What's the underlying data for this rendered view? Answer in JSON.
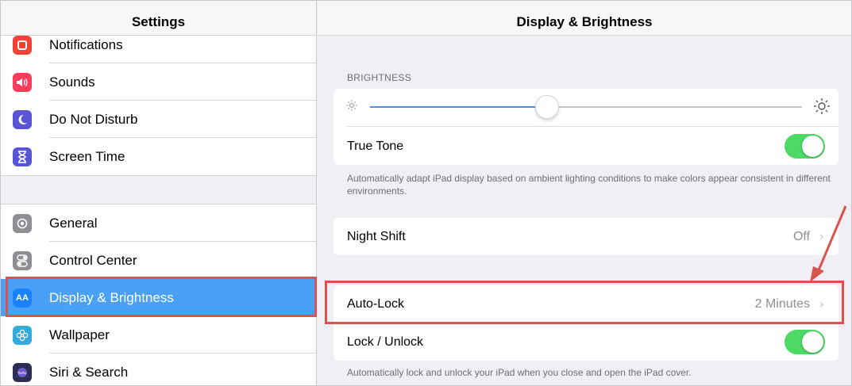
{
  "sidebar": {
    "title": "Settings",
    "items": [
      {
        "label": "Notifications",
        "icon": "notifications-icon",
        "color": "#f44336"
      },
      {
        "label": "Sounds",
        "icon": "speaker-icon",
        "color": "#ff3b5c"
      },
      {
        "label": "Do Not Disturb",
        "icon": "moon-icon",
        "color": "#5856d6"
      },
      {
        "label": "Screen Time",
        "icon": "hourglass-icon",
        "color": "#5856d6"
      },
      {
        "label": "General",
        "icon": "gear-icon",
        "color": "#8e8e93"
      },
      {
        "label": "Control Center",
        "icon": "toggles-icon",
        "color": "#8e8e93"
      },
      {
        "label": "Display & Brightness",
        "icon": "text-size-icon",
        "color": "#1a82fb",
        "glyph": "AA"
      },
      {
        "label": "Wallpaper",
        "icon": "flower-icon",
        "color": "#35aadc"
      },
      {
        "label": "Siri & Search",
        "icon": "siri-icon",
        "color": "#2c2c54"
      }
    ]
  },
  "detail": {
    "title": "Display & Brightness",
    "brightness_label": "BRIGHTNESS",
    "brightness_level": 0.41,
    "true_tone": {
      "label": "True Tone",
      "on": true
    },
    "true_tone_note": "Automatically adapt iPad display based on ambient lighting conditions to make colors appear consistent in different environments.",
    "night_shift": {
      "label": "Night Shift",
      "value": "Off"
    },
    "auto_lock": {
      "label": "Auto-Lock",
      "value": "2 Minutes"
    },
    "lock_unlock": {
      "label": "Lock / Unlock",
      "on": true
    },
    "lock_note": "Automatically lock and unlock your iPad when you close and open the iPad cover."
  },
  "colors": {
    "accent": "#4aa0f5",
    "toggle_on": "#4cd964",
    "highlight": "#d9534f"
  }
}
